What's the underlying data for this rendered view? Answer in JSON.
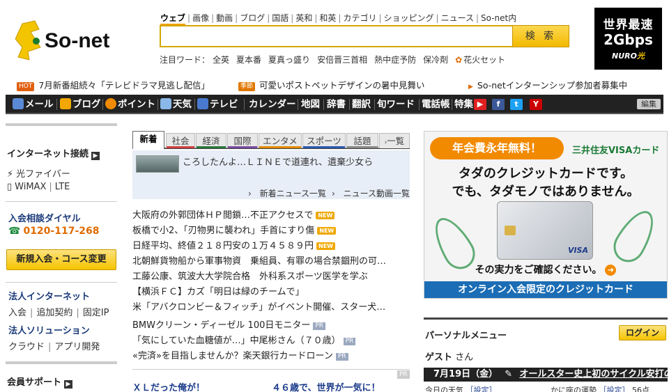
{
  "header": {
    "logo_text": "So-net",
    "search_tabs": [
      "ウェブ",
      "画像",
      "動画",
      "ブログ",
      "国語",
      "英和",
      "和英",
      "カテゴリ",
      "ショッピング",
      "ニュース",
      "So-net内"
    ],
    "search_placeholder": "",
    "search_button": "検 索",
    "hot_label": "注目ワード：",
    "hot_words": [
      "全英",
      "夏本番",
      "夏真っ盛り",
      "安倍晋三首相",
      "熱中症予防",
      "保冷剤"
    ],
    "hot_special": "花火セット",
    "nuro": {
      "line1": "世界最速",
      "line2": "2Gbps",
      "line3a": "NURO",
      "line3b": "光"
    }
  },
  "notices": [
    {
      "badge": "HOT",
      "text": "7月新番組続々「テレビドラマ見逃し配信」"
    },
    {
      "badge": "季節",
      "text": "可愛いポストペットデザインの暑中見舞い"
    },
    {
      "badge": "",
      "text": "So-netインターンシップ参加者募集中"
    }
  ],
  "navbar": {
    "items": [
      "メール",
      "ブログ",
      "ポイント",
      "天気",
      "テレビ",
      "カレンダー",
      "地図",
      "辞書",
      "翻訳",
      "旬ワード",
      "電話帳",
      "特集"
    ],
    "edit": "編集"
  },
  "left": {
    "internet_head": "インターネット接続",
    "fiber": "光ファイバー",
    "wimax": "WiMAX",
    "lte": "LTE",
    "dial_head": "入会相談ダイヤル",
    "tel": "0120-117-268",
    "join_btn": "新規入会・コース変更",
    "corp_head": "法人インターネット",
    "corp_links": [
      "入会",
      "追加契約",
      "固定IP"
    ],
    "sol_head": "法人ソリューション",
    "sol_links": [
      "クラウド",
      "アプリ開発"
    ],
    "support_head": "会員サポート"
  },
  "news": {
    "tabs": [
      "新着",
      "社会",
      "経済",
      "国際",
      "エンタメ",
      "スポーツ",
      "話題",
      "一覧"
    ],
    "feature_text": "ころしたんよ…ＬＩＮＥで道連れ、遺棄少女ら",
    "feature_links": [
      "新着ニュース一覧",
      "ニュース動画一覧"
    ],
    "items": [
      {
        "text": "大阪府の外郭団体ＨＰ閲鎖…不正アクセスで",
        "new": "NEW"
      },
      {
        "text": "板橋で小2、「刃物男に襲われ」手首にすり傷",
        "new": "NEW"
      },
      {
        "text": "日経平均、終値２１８円安の１万４５８９円",
        "new": "NEW"
      },
      {
        "text": "北朝鮮貨物船から軍事物資　乗組員、有罪の場合禁錮刑の可…",
        "new": ""
      },
      {
        "text": "工藤公康、筑波大大学院合格　外科系スポーツ医学を学ぶ",
        "new": ""
      },
      {
        "text": "【横浜ＦＣ】カズ「明日は緑のチームで」",
        "new": ""
      },
      {
        "text": "米「アバクロンビー＆フィッチ」がイベント開催、スター犬…",
        "new": ""
      }
    ],
    "pr_items": [
      "BMWクリーン・ディーゼル 100日モニター",
      "「気にしていた血糖値が…」中尾彬さん（７０歳）",
      "«完済»を目指しませんか？楽天銀行カードローン"
    ],
    "pr_label": "PR",
    "bottom": [
      "ＸＬだった俺が！",
      "４６歳で、世界が一気に！"
    ]
  },
  "ad": {
    "pill": "年会費永年無料！",
    "brand": "三井住友VISAカード",
    "line1": "タダのクレジットカードです。",
    "line2": "でも、タダモノではありません。",
    "check": "その実力をご確認ください。",
    "foot": "オンライン入会限定のクレジットカード",
    "card_brand": "VISA"
  },
  "personal": {
    "title": "パーソナルメニュー",
    "login": "ログイン",
    "guest": "ゲスト",
    "san": "さん",
    "date": "7月19日（金）",
    "headline": "オールスター史上初のサイクル安打の日",
    "weather": "今日の天気",
    "setting": "［設定］",
    "horoscope": "かに座の運勢",
    "score": "56点"
  },
  "colors": {
    "accent": "#f5c400",
    "nav_bg": "#222222",
    "link_navy": "#1a3a8a",
    "orange": "#e06b00"
  }
}
